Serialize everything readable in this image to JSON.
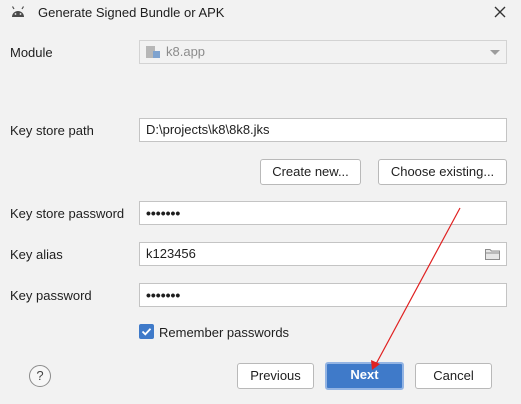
{
  "window": {
    "title": "Generate Signed Bundle or APK",
    "close_icon": "close-icon"
  },
  "module": {
    "label": "Module",
    "value": "k8.app"
  },
  "key_store_path": {
    "label": "Key store path",
    "value": "D:\\projects\\k8\\8k8.jks"
  },
  "buttons": {
    "create_new": "Create new...",
    "choose_existing": "Choose existing...",
    "previous": "Previous",
    "next": "Next",
    "cancel": "Cancel",
    "help": "?"
  },
  "key_store_password": {
    "label": "Key store password",
    "masked_value": "•••••••"
  },
  "key_alias": {
    "label": "Key alias",
    "value": "k123456"
  },
  "key_password": {
    "label": "Key password",
    "masked_value": "•••••••"
  },
  "remember_passwords": {
    "label": "Remember passwords",
    "checked": true
  },
  "colors": {
    "accent": "#3f7ac9",
    "annotation_arrow": "#e02020",
    "background": "#f2f2f2"
  }
}
